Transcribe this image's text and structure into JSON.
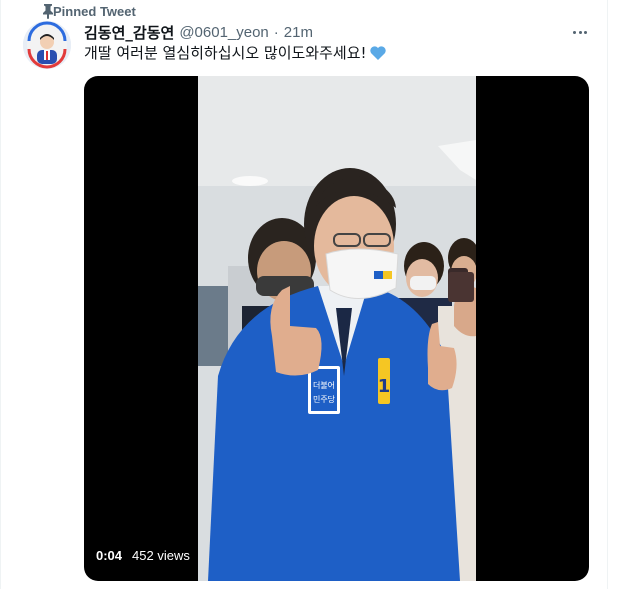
{
  "pinned_label": "Pinned Tweet",
  "tweet": {
    "display_name": "김동연_감동연",
    "handle": "@0601_yeon",
    "separator": "·",
    "time": "21m",
    "text": "개딸 여러분 열심히하십시오 많이도와주세요!",
    "emoji": "blue-heart",
    "badge_text": "1"
  },
  "video": {
    "duration": "0:04",
    "views": "452 views",
    "shirt_text": "더불어 민주당"
  },
  "colors": {
    "secondary_text": "#536471",
    "jacket_blue": "#1e5fc6",
    "heart_blue": "#5aa9e6"
  }
}
